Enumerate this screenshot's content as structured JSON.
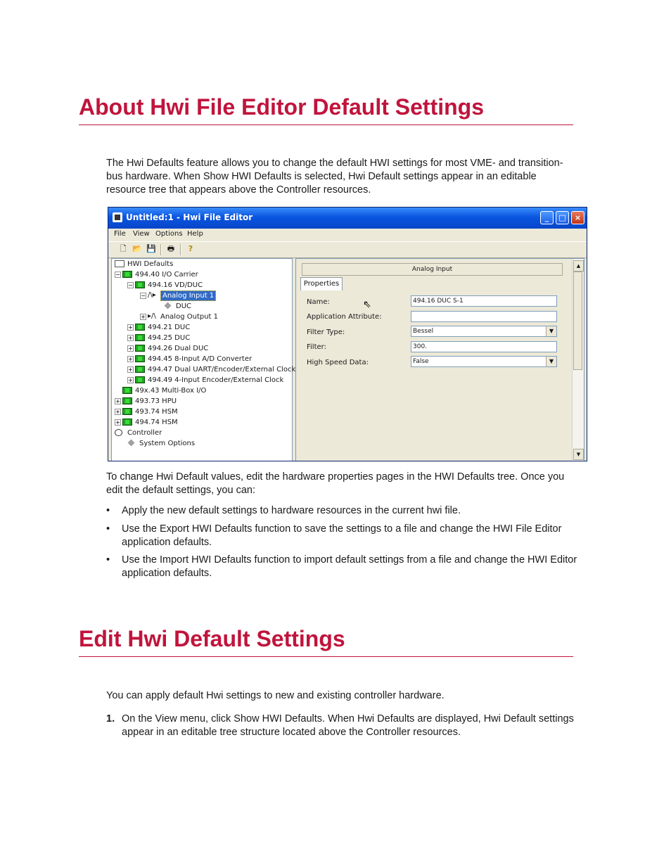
{
  "section1": {
    "heading": "About Hwi File Editor Default Settings",
    "intro": "The Hwi Defaults feature allows you to change the default HWI settings for most VME- and transition-bus hardware. When Show HWI Defaults is selected, Hwi Default settings appear in an editable resource tree that appears above the Controller resources.",
    "after_figure": "To change Hwi Default values, edit the hardware properties pages in the HWI Defaults tree. Once you edit the default settings, you can:",
    "bullets": [
      "Apply the new default settings to hardware resources in the current hwi file.",
      "Use the Export HWI Defaults function to save the settings to a file and change the HWI File Editor application defaults.",
      "Use the Import HWI Defaults function to import default settings from a file and change the HWI Editor application defaults."
    ]
  },
  "section2": {
    "heading": "Edit Hwi Default Settings",
    "intro": "You can apply default Hwi settings to new and existing controller hardware.",
    "steps": [
      {
        "n": "1.",
        "text": "On the View menu, click Show HWI Defaults. When Hwi Defaults are displayed, Hwi Default settings appear in an editable tree structure located above the Controller resources."
      }
    ]
  },
  "window": {
    "title": "Untitled:1 - Hwi File Editor",
    "minimize": "_",
    "maximize": "□",
    "close": "×",
    "menu": [
      "File",
      "View",
      "Options",
      "Help"
    ],
    "toolbar_icons": [
      "new-icon",
      "open-icon",
      "save-icon",
      "print-icon",
      "help-icon"
    ],
    "tree": [
      {
        "label": "HWI Defaults",
        "icon": "grid",
        "exp": ""
      },
      {
        "label": "494.40 I/O Carrier",
        "icon": "board",
        "exp": "−"
      },
      {
        "label": "494.16 VD/DUC",
        "icon": "board",
        "exp": "−"
      },
      {
        "label": "Analog Input 1",
        "icon": "sig",
        "exp": "−",
        "selected": true
      },
      {
        "label": "DUC",
        "icon": "diamond",
        "exp": ""
      },
      {
        "label": "Analog Output 1",
        "icon": "sig",
        "exp": "+"
      },
      {
        "label": "494.21 DUC",
        "icon": "board",
        "exp": "+"
      },
      {
        "label": "494.25 DUC",
        "icon": "board",
        "exp": "+"
      },
      {
        "label": "494.26 Dual DUC",
        "icon": "board",
        "exp": "+"
      },
      {
        "label": "494.45 8-Input A/D Converter",
        "icon": "board",
        "exp": "+"
      },
      {
        "label": "494.47 Dual UART/Encoder/External Clock",
        "icon": "board",
        "exp": "+"
      },
      {
        "label": "494.49 4-Input Encoder/External Clock",
        "icon": "board",
        "exp": "+"
      },
      {
        "label": "49x.43 Multi-Box I/O",
        "icon": "board",
        "exp": ""
      },
      {
        "label": "493.73 HPU",
        "icon": "board",
        "exp": "+"
      },
      {
        "label": "493.74 HSM",
        "icon": "board",
        "exp": "+"
      },
      {
        "label": "494.74 HSM",
        "icon": "board",
        "exp": "+"
      },
      {
        "label": "Controller",
        "icon": "ctrl",
        "exp": ""
      },
      {
        "label": "System Options",
        "icon": "diamond",
        "exp": ""
      }
    ],
    "panel_header": "Analog Input",
    "tab": "Properties",
    "fields": [
      {
        "label": "Name:",
        "value": "494.16 DUC S-1",
        "dropdown": false
      },
      {
        "label": "Application Attribute:",
        "value": "",
        "dropdown": false
      },
      {
        "label": "Filter Type:",
        "value": "Bessel",
        "dropdown": true
      },
      {
        "label": "Filter:",
        "value": "300.",
        "dropdown": false
      },
      {
        "label": "High Speed Data:",
        "value": "False",
        "dropdown": true
      }
    ]
  }
}
